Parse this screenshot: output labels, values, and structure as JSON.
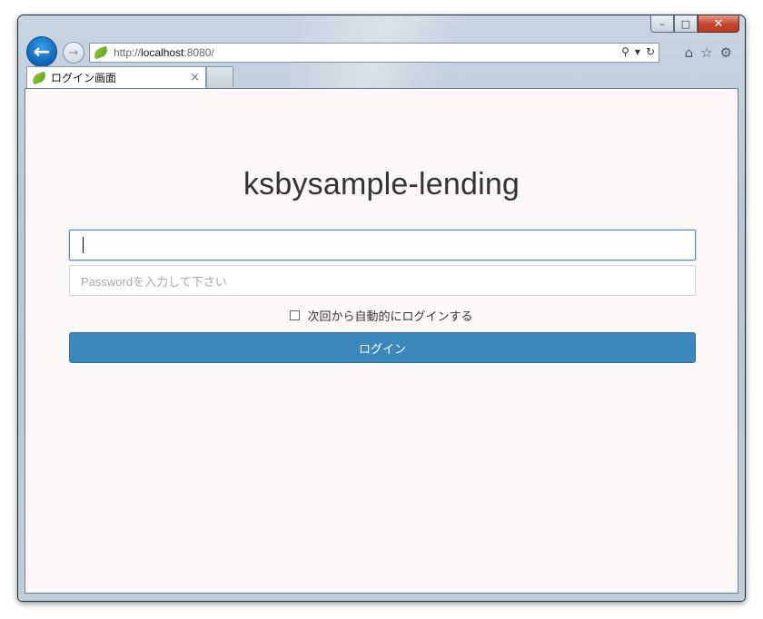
{
  "window": {
    "controls": {
      "minimize": "–",
      "maximize": "□",
      "close": "✕"
    }
  },
  "nav": {
    "back_icon": "arrow-left",
    "forward_icon": "arrow-right",
    "address": {
      "scheme": "http://",
      "host": "localhost",
      "rest": ":8080/"
    },
    "address_icons": [
      "search-icon",
      "dropdown-icon",
      "refresh-icon"
    ],
    "toolbar_icons": [
      "home-icon",
      "star-icon",
      "gear-icon"
    ]
  },
  "tabs": [
    {
      "label": "ログイン画面",
      "close": "×"
    }
  ],
  "page": {
    "title": "ksbysample-lending",
    "username": {
      "value": ""
    },
    "password": {
      "placeholder": "Passwordを入力して下さい"
    },
    "remember_me": {
      "label": "次回から自動的にログインする",
      "checked": false
    },
    "login_button": {
      "label": "ログイン"
    },
    "colors": {
      "primary": "#3b89bc",
      "background": "#fcf8f7",
      "focus_border": "#5b8cb7"
    }
  }
}
